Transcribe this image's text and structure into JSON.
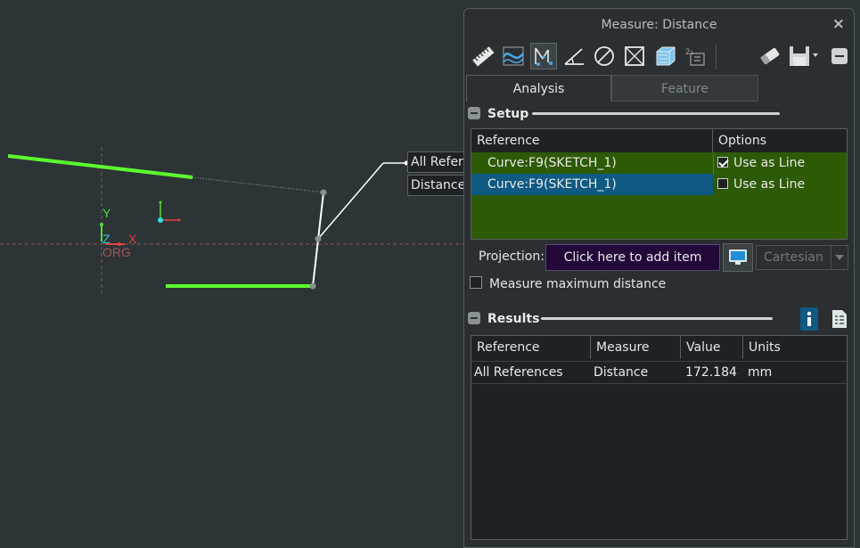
{
  "window": {
    "title": "Measure: Distance",
    "close_glyph": "×"
  },
  "toolbar": {
    "left": [
      {
        "name": "ruler-icon"
      },
      {
        "name": "curve-icon"
      },
      {
        "name": "distance-measure-icon",
        "active": true
      },
      {
        "name": "angle-icon"
      },
      {
        "name": "diameter-icon"
      },
      {
        "name": "area-icon"
      },
      {
        "name": "volume-icon"
      },
      {
        "name": "transform-icon"
      }
    ],
    "right": [
      {
        "name": "eraser-icon"
      },
      {
        "name": "save-icon"
      },
      {
        "name": "minimize-icon"
      }
    ]
  },
  "tabs": [
    {
      "label": "Analysis",
      "active": true
    },
    {
      "label": "Feature",
      "active": false
    }
  ],
  "setup": {
    "title": "Setup",
    "columns": [
      "Reference",
      "Options"
    ],
    "rows": [
      {
        "reference": "Curve:F9(SKETCH_1)",
        "option": "Use as Line",
        "checked": true,
        "selected": false
      },
      {
        "reference": "Curve:F9(SKETCH_1)",
        "option": "Use as Line",
        "checked": false,
        "selected": true
      }
    ],
    "projection_label": "Projection:",
    "projection_button": "Click here to add item",
    "coordinate_system": "Cartesian",
    "max_distance_label": "Measure maximum distance",
    "max_distance_checked": false
  },
  "results": {
    "title": "Results",
    "columns": [
      "Reference",
      "Measure",
      "Value",
      "Units"
    ],
    "rows": [
      {
        "reference": "All References",
        "measure": "Distance",
        "value": "172.184",
        "units": "mm"
      }
    ]
  },
  "viewport": {
    "callout": [
      "All References",
      "Distance"
    ],
    "axis_labels": {
      "y": "Y",
      "z": "Z",
      "x": "X",
      "origin": "ORG"
    }
  },
  "colors": {
    "accent_green": "#5cff2e",
    "selection_blue": "#0e5a82",
    "row_green": "#2d5a05",
    "projection_button_bg": "#23083a"
  }
}
